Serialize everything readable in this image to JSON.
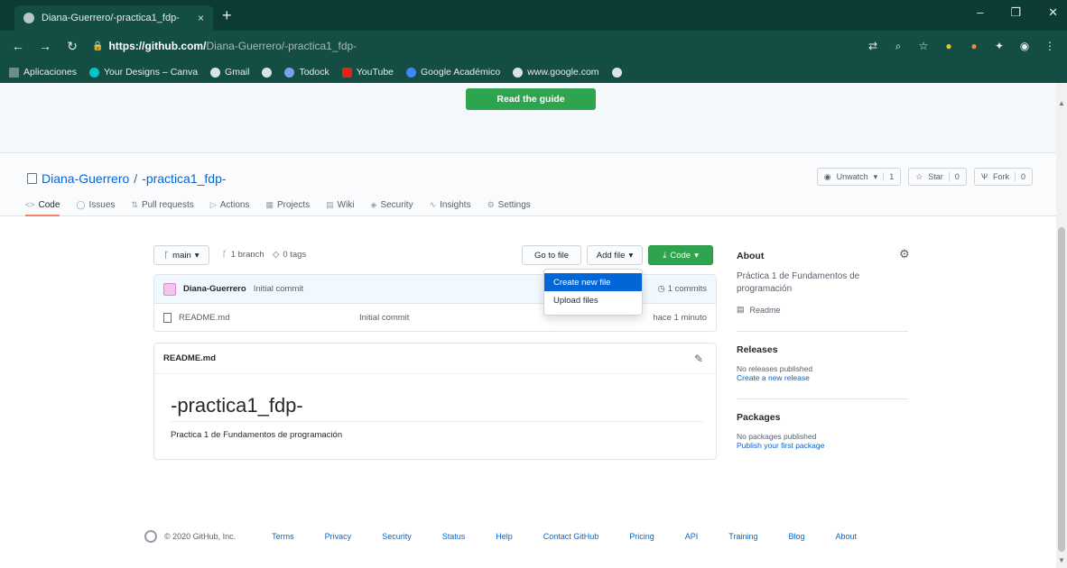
{
  "browser": {
    "tab_title": "Diana-Guerrero/-practica1_fdp-",
    "tab_close": "×",
    "new_tab": "+",
    "url_domain": "https://github.com/",
    "url_path": "Diana-Guerrero/-practica1_fdp-",
    "bookmarks": [
      {
        "label": "Aplicaciones",
        "color": "#6b8e88"
      },
      {
        "label": "Your Designs – Canva",
        "color": "#00c4cc"
      },
      {
        "label": "Gmail",
        "color": "#4a7a70"
      },
      {
        "label": "",
        "color": "#4a7a70"
      },
      {
        "label": "Todock",
        "color": "#4a7a70"
      },
      {
        "label": "YouTube",
        "color": "#e62117"
      },
      {
        "label": "Google Académico",
        "color": "#4285f4"
      },
      {
        "label": "www.google.com",
        "color": "#4a7a70"
      }
    ]
  },
  "banner": {
    "guide_button": "Read the guide"
  },
  "repo": {
    "owner": "Diana-Guerrero",
    "separator": "/",
    "name": "-practica1_fdp-",
    "actions": [
      {
        "label": "Unwatch",
        "count": "1"
      },
      {
        "label": "Star",
        "count": "0"
      },
      {
        "label": "Fork",
        "count": "0"
      }
    ],
    "tabs": [
      {
        "label": "Code",
        "icon": "<>"
      },
      {
        "label": "Issues",
        "icon": "◯"
      },
      {
        "label": "Pull requests",
        "icon": "⇅"
      },
      {
        "label": "Actions",
        "icon": "▷"
      },
      {
        "label": "Projects",
        "icon": "▦"
      },
      {
        "label": "Wiki",
        "icon": "▤"
      },
      {
        "label": "Security",
        "icon": "◈"
      },
      {
        "label": "Insights",
        "icon": "∿"
      },
      {
        "label": "Settings",
        "icon": "⚙"
      }
    ]
  },
  "code": {
    "branch": "main",
    "branches": "1 branch",
    "tags": "0 tags",
    "go_to_file": "Go to file",
    "add_file": "Add file",
    "code_button": "Code",
    "commit_author": "Diana-Guerrero",
    "commit_message": "Initial commit",
    "commits": "1 commits",
    "files": [
      {
        "name": "README.md",
        "message": "Initial commit",
        "time": "hace 1 minuto"
      }
    ],
    "dropdown": [
      "Create new file",
      "Upload files"
    ]
  },
  "readme": {
    "filename": "README.md",
    "heading": "-practica1_fdp-",
    "body": "Practica 1 de Fundamentos de programación"
  },
  "about": {
    "title": "About",
    "description": "Práctica 1 de Fundamentos de programación",
    "readme_link": "Readme",
    "releases_title": "Releases",
    "releases_none": "No releases published",
    "releases_link": "Create a new release",
    "packages_title": "Packages",
    "packages_none": "No packages published",
    "packages_link": "Publish your first package"
  },
  "footer": {
    "copyright": "© 2020 GitHub, Inc.",
    "links": [
      "Terms",
      "Privacy",
      "Security",
      "Status",
      "Help",
      "Contact GitHub",
      "Pricing",
      "API",
      "Training",
      "Blog",
      "About"
    ]
  }
}
